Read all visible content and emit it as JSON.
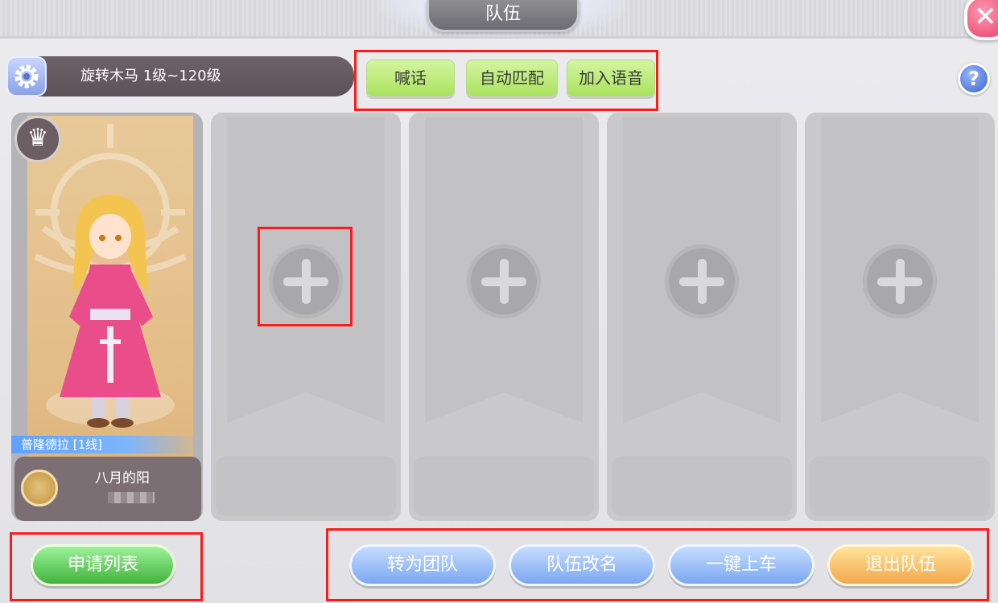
{
  "header": {
    "title": "队伍",
    "close_icon": "close-icon",
    "close_glyph": "✕"
  },
  "topic": {
    "text": "旋转木马 1级~120级",
    "gear_icon": "gear-icon"
  },
  "top_actions": [
    {
      "label": "喊话"
    },
    {
      "label": "自动匹配"
    },
    {
      "label": "加入语音"
    }
  ],
  "help": {
    "glyph": "?"
  },
  "leader": {
    "crown_glyph": "♛",
    "server": "普隆德拉  [1线]",
    "name": "八月的阳"
  },
  "empty_slots": 4,
  "bottom": {
    "apply_list": "申请列表",
    "convert_team": "转为团队",
    "rename": "队伍改名",
    "one_click": "一键上车",
    "leave": "退出队伍"
  },
  "colors": {
    "accent_green": "#a9e35e",
    "accent_blue": "#7aa8f0",
    "accent_orange": "#f2a74c",
    "highlight_red": "#ff1a1a"
  }
}
